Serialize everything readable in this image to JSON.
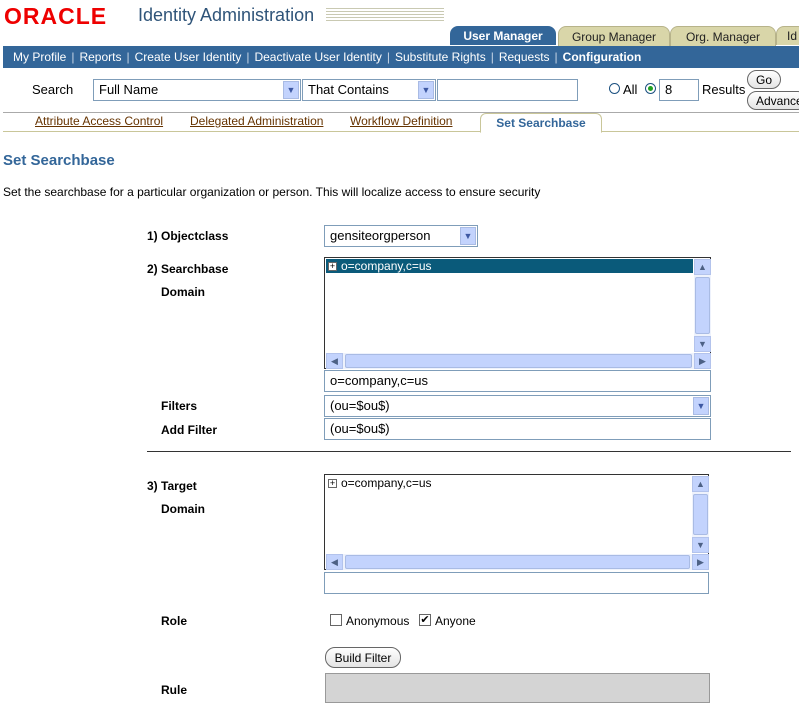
{
  "header": {
    "logo": "ORACLE",
    "app_title": "Identity Administration"
  },
  "tabs": [
    {
      "label": "User Manager",
      "active": true
    },
    {
      "label": "Group Manager",
      "active": false
    },
    {
      "label": "Org. Manager",
      "active": false
    },
    {
      "label": "Id",
      "active": false
    }
  ],
  "nav": {
    "items": [
      "My Profile",
      "Reports",
      "Create User Identity",
      "Deactivate User Identity",
      "Substitute Rights",
      "Requests",
      "Configuration"
    ],
    "separator": "|",
    "current": "Configuration"
  },
  "search": {
    "label": "Search",
    "field_select": "Full Name",
    "operator_select": "That Contains",
    "query_value": "",
    "all_label": "All",
    "results_count": "8",
    "results_label": "Results",
    "go_label": "Go",
    "advanced_label": "Advance"
  },
  "subtabs": [
    {
      "label": "Attribute Access Control",
      "active": false
    },
    {
      "label": "Delegated Administration",
      "active": false
    },
    {
      "label": "Workflow Definition",
      "active": false
    },
    {
      "label": "Set Searchbase",
      "active": true
    }
  ],
  "page": {
    "title": "Set Searchbase",
    "description": "Set the searchbase for a particular organization or person. This will localize access to ensure security"
  },
  "form": {
    "objectclass_label": "1)  Objectclass",
    "objectclass_value": "gensiteorgperson",
    "searchbase_label": "2)  Searchbase",
    "searchbase_domain_label": "Domain",
    "searchbase_tree_node": "o=company,c=us",
    "searchbase_value": "o=company,c=us",
    "filters_label": "Filters",
    "filters_value": "(ou=$ou$)",
    "add_filter_label": "Add Filter",
    "add_filter_value": "(ou=$ou$)",
    "target_label": "3)  Target",
    "target_domain_label": "Domain",
    "target_tree_node": "o=company,c=us",
    "target_value": "",
    "role_label": "Role",
    "role_anonymous": "Anonymous",
    "role_anyone": "Anyone",
    "build_filter_label": "Build Filter",
    "rule_label": "Rule"
  },
  "icons": {
    "dropdown": "chevron-down-icon",
    "tree_expand": "plus-icon",
    "check": "✔"
  },
  "colors": {
    "brand_red": "#e00000",
    "nav_blue": "#336699",
    "tab_tan": "#d9d6a9",
    "selection": "#0a5a7a"
  }
}
